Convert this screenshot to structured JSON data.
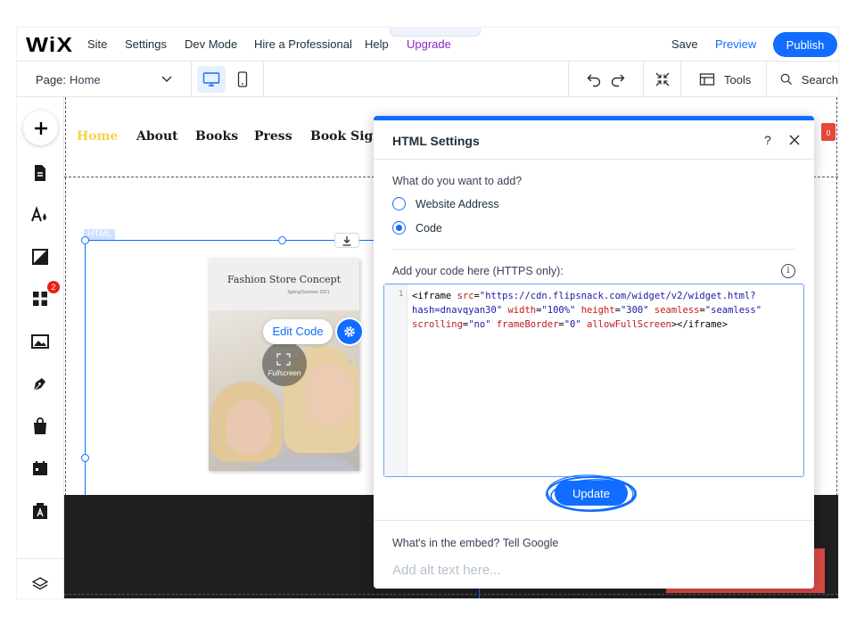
{
  "topbar": {
    "logo": "WiX",
    "menu": [
      "Site",
      "Settings",
      "Dev Mode",
      "Hire a Professional",
      "Help"
    ],
    "upgrade": "Upgrade",
    "collapse_arrow": "^",
    "save": "Save",
    "preview": "Preview",
    "publish": "Publish"
  },
  "secondary_bar": {
    "page_label": "Page:",
    "page_value": "Home",
    "tools": "Tools",
    "search": "Search"
  },
  "sidebar": {
    "items": [
      "add-icon",
      "pages-icon",
      "theme-icon",
      "background-icon",
      "apps-icon",
      "media-icon",
      "blog-icon",
      "store-icon",
      "bookings-icon",
      "portfolio-icon",
      "layers-icon"
    ],
    "apps_badge": "2"
  },
  "site": {
    "nav": [
      "Home",
      "About",
      "Books",
      "Press",
      "Book Signi"
    ],
    "cart_count": "0",
    "html_tag": "HTML",
    "magazine_title": "Fashion Store Concept",
    "magazine_subtitle": "Spring/Summer 2021",
    "fullscreen": "Fullscreen",
    "edit_code": "Edit Code"
  },
  "panel": {
    "title": "HTML Settings",
    "help": "?",
    "question": "What do you want to add?",
    "options": [
      "Website Address",
      "Code"
    ],
    "selected_option": "Code",
    "code_label": "Add your code here (HTTPS only):",
    "info": "i",
    "line_number": "1",
    "code_lines": [
      [
        {
          "t": "tag",
          "v": "<iframe "
        },
        {
          "t": "attr",
          "v": "src"
        },
        {
          "t": "tag",
          "v": "="
        },
        {
          "t": "val",
          "v": "\"https://cdn.flipsnack.com/widget/v2/widget.html?"
        }
      ],
      [
        {
          "t": "val",
          "v": "hash=dnavqyan30\""
        },
        {
          "t": "tag",
          "v": " "
        },
        {
          "t": "attr",
          "v": "width"
        },
        {
          "t": "tag",
          "v": "="
        },
        {
          "t": "val",
          "v": "\"100%\""
        },
        {
          "t": "tag",
          "v": " "
        },
        {
          "t": "attr",
          "v": "height"
        },
        {
          "t": "tag",
          "v": "="
        },
        {
          "t": "val",
          "v": "\"300\""
        },
        {
          "t": "tag",
          "v": " "
        },
        {
          "t": "attr",
          "v": "seamless"
        },
        {
          "t": "tag",
          "v": "="
        },
        {
          "t": "val",
          "v": "\"seamless\""
        }
      ],
      [
        {
          "t": "attr",
          "v": "scrolling"
        },
        {
          "t": "tag",
          "v": "="
        },
        {
          "t": "val",
          "v": "\"no\""
        },
        {
          "t": "tag",
          "v": " "
        },
        {
          "t": "attr",
          "v": "frameBorder"
        },
        {
          "t": "tag",
          "v": "="
        },
        {
          "t": "val",
          "v": "\"0\""
        },
        {
          "t": "tag",
          "v": " "
        },
        {
          "t": "attr",
          "v": "allowFullScreen"
        },
        {
          "t": "tag",
          "v": "></iframe>"
        }
      ]
    ],
    "update": "Update",
    "embed_label": "What's in the embed? Tell Google",
    "alt_placeholder": "Add alt text here..."
  },
  "colors": {
    "accent": "#116dff",
    "upgrade": "#8b25c9",
    "badge": "#e62214",
    "nav_home": "#f5d34a"
  }
}
